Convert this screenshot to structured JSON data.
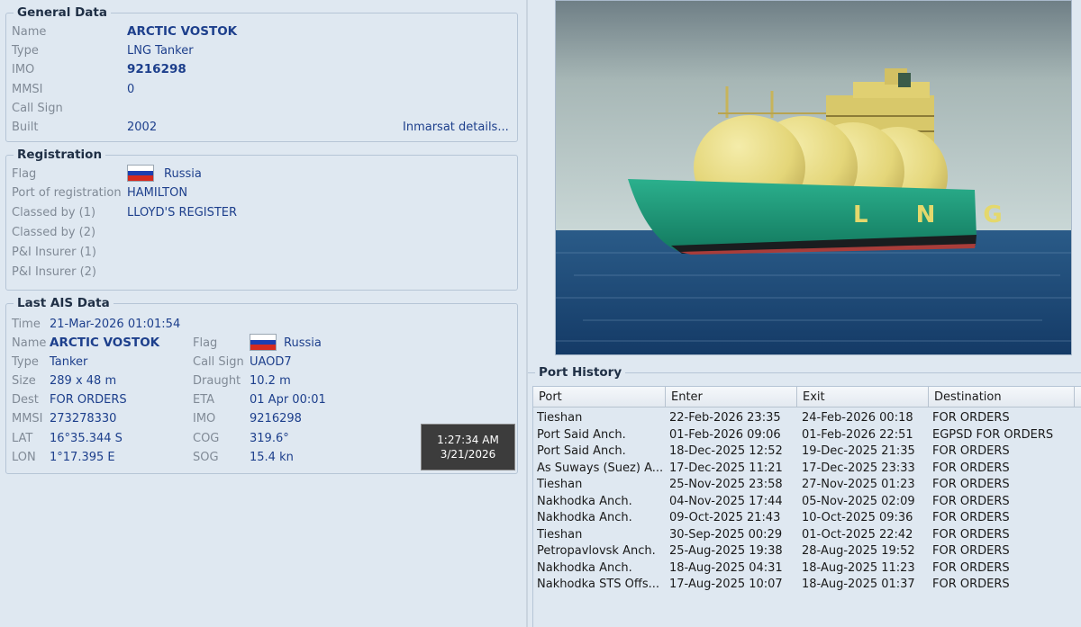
{
  "general": {
    "title": "General Data",
    "name_label": "Name",
    "name": "ARCTIC VOSTOK",
    "type_label": "Type",
    "type": "LNG Tanker",
    "imo_label": "IMO",
    "imo": "9216298",
    "mmsi_label": "MMSI",
    "mmsi": "0",
    "callsign_label": "Call Sign",
    "built_label": "Built",
    "built": "2002",
    "inmarsat_link": "Inmarsat details..."
  },
  "registration": {
    "title": "Registration",
    "flag_label": "Flag",
    "flag": "Russia",
    "port_label": "Port of registration",
    "port": "HAMILTON",
    "class1_label": "Classed by (1)",
    "class1": "LLOYD'S REGISTER",
    "class2_label": "Classed by (2)",
    "pi1_label": "P&I Insurer (1)",
    "pi2_label": "P&I Insurer (2)"
  },
  "ais": {
    "title": "Last AIS Data",
    "time_label": "Time",
    "time": "21-Mar-2026 01:01:54",
    "name_label": "Name",
    "name": "ARCTIC VOSTOK",
    "flag_label": "Flag",
    "flag": "Russia",
    "type_label": "Type",
    "type": "Tanker",
    "callsign_label": "Call Sign",
    "callsign": "UAOD7",
    "size_label": "Size",
    "size": "289 x 48 m",
    "draught_label": "Draught",
    "draught": "10.2 m",
    "dest_label": "Dest",
    "dest": "FOR ORDERS",
    "eta_label": "ETA",
    "eta": "01 Apr 00:01",
    "mmsi_label": "MMSI",
    "mmsi": "273278330",
    "imo_label": "IMO",
    "imo": "9216298",
    "lat_label": "LAT",
    "lat": "16°35.344 S",
    "cog_label": "COG",
    "cog": "319.6°",
    "lon_label": "LON",
    "lon": "1°17.395 E",
    "sog_label": "SOG",
    "sog": "15.4 kn"
  },
  "tooltip": {
    "time": "1:27:34 AM",
    "date": "3/21/2026"
  },
  "flag_colors": [
    "#ffffff",
    "#1c3fb0",
    "#d52b1e"
  ],
  "ship_hull_text": "L N G",
  "port_history": {
    "title": "Port History",
    "columns": [
      "Port",
      "Enter",
      "Exit",
      "Destination"
    ],
    "rows": [
      [
        "Tieshan",
        "22-Feb-2026 23:35",
        "24-Feb-2026 00:18",
        "FOR ORDERS"
      ],
      [
        "Port Said Anch.",
        "01-Feb-2026 09:06",
        "01-Feb-2026 22:51",
        "EGPSD FOR ORDERS"
      ],
      [
        "Port Said Anch.",
        "18-Dec-2025 12:52",
        "19-Dec-2025 21:35",
        "FOR ORDERS"
      ],
      [
        "As Suways (Suez) A...",
        "17-Dec-2025 11:21",
        "17-Dec-2025 23:33",
        "FOR ORDERS"
      ],
      [
        "Tieshan",
        "25-Nov-2025 23:58",
        "27-Nov-2025 01:23",
        "FOR ORDERS"
      ],
      [
        "Nakhodka Anch.",
        "04-Nov-2025 17:44",
        "05-Nov-2025 02:09",
        "FOR ORDERS"
      ],
      [
        "Nakhodka Anch.",
        "09-Oct-2025 21:43",
        "10-Oct-2025 09:36",
        "FOR ORDERS"
      ],
      [
        "Tieshan",
        "30-Sep-2025 00:29",
        "01-Oct-2025 22:42",
        "FOR ORDERS"
      ],
      [
        "Petropavlovsk Anch.",
        "25-Aug-2025 19:38",
        "28-Aug-2025 19:52",
        "FOR ORDERS"
      ],
      [
        "Nakhodka Anch.",
        "18-Aug-2025 04:31",
        "18-Aug-2025 11:23",
        "FOR ORDERS"
      ],
      [
        "Nakhodka STS Offs...",
        "17-Aug-2025 10:07",
        "18-Aug-2025 01:37",
        "FOR ORDERS"
      ]
    ]
  }
}
